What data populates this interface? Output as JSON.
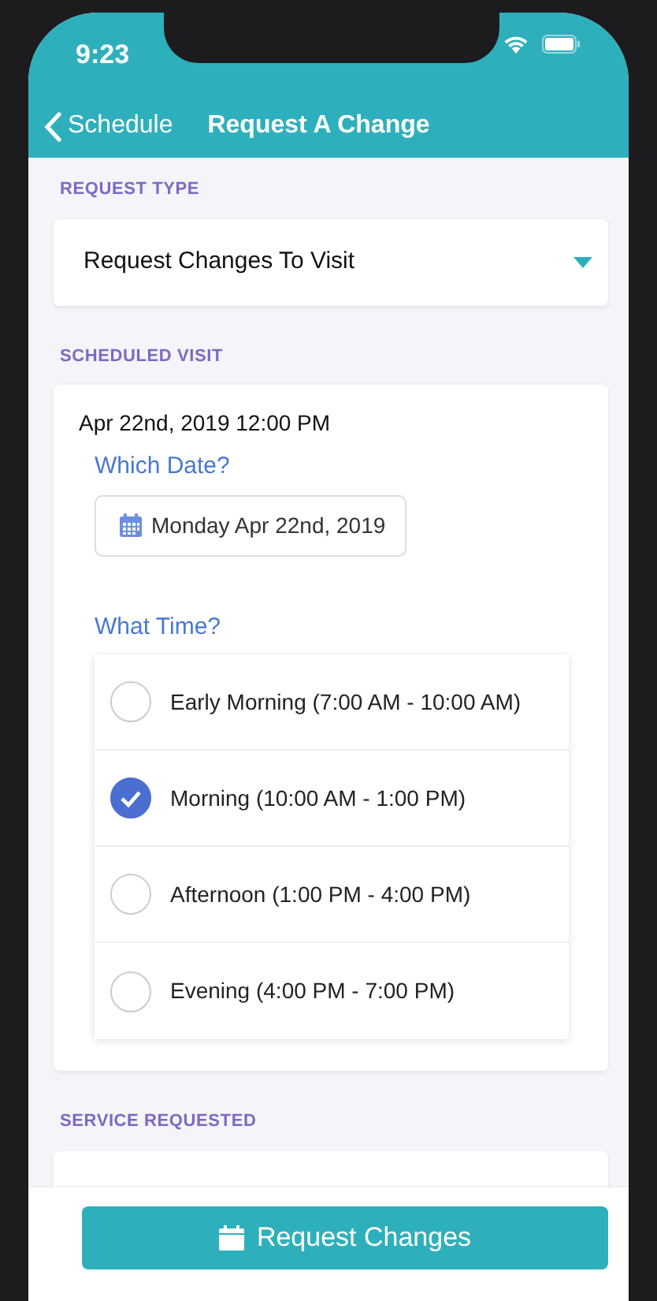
{
  "status_bar": {
    "time": "9:23"
  },
  "nav": {
    "back": "Schedule",
    "title": "Request A Change"
  },
  "sections": [
    {
      "label": "REQUEST TYPE",
      "kind": "select",
      "value": "Request Changes To Visit"
    },
    {
      "label": "SCHEDULED VISIT",
      "kind": "visit",
      "current": "Apr 22nd, 2019 12:00 PM",
      "date_label": "Which Date?",
      "date_value": "Monday Apr 22nd, 2019",
      "time_label": "What Time?",
      "options": [
        {
          "label": "Early Morning (7:00 AM - 10:00 AM)",
          "selected": false
        },
        {
          "label": "Morning (10:00 AM - 1:00 PM)",
          "selected": true
        },
        {
          "label": "Afternoon (1:00 PM - 4:00 PM)",
          "selected": false
        },
        {
          "label": "Evening (4:00 PM - 7:00 PM)",
          "selected": false
        }
      ]
    },
    {
      "label": "SERVICE REQUESTED",
      "kind": "service"
    }
  ],
  "button": "Request Changes"
}
